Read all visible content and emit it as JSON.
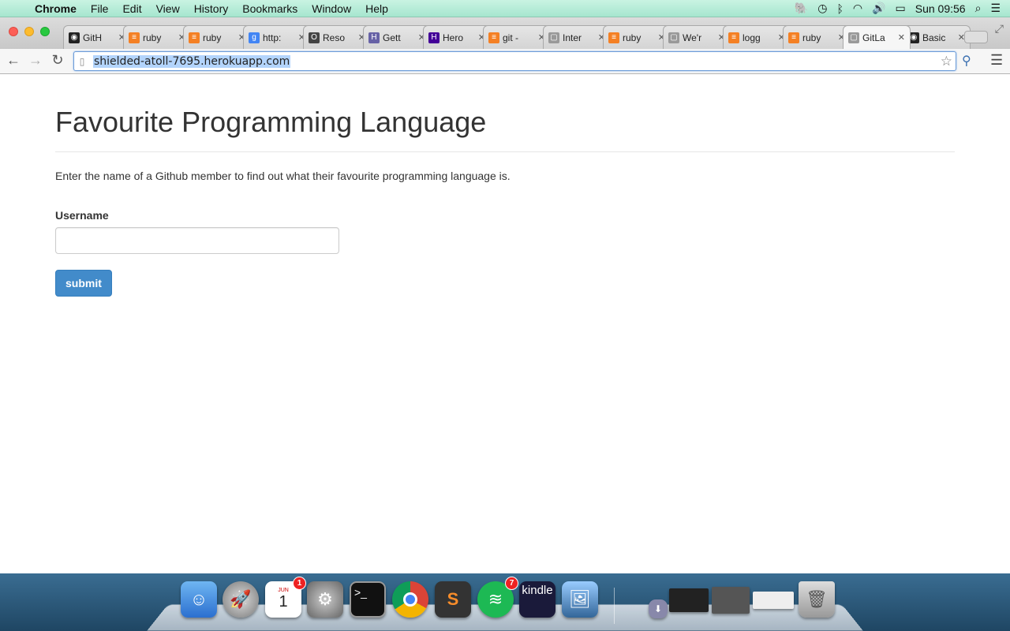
{
  "menubar": {
    "app_name": "Chrome",
    "menus": [
      "File",
      "Edit",
      "View",
      "History",
      "Bookmarks",
      "Window",
      "Help"
    ],
    "clock": "Sun 09:56"
  },
  "tabs": [
    {
      "title": "GitH",
      "icon": "github-icon",
      "color": "#222222",
      "glyph": "◉"
    },
    {
      "title": "ruby",
      "icon": "stackoverflow-icon",
      "color": "#f48024",
      "glyph": "≡"
    },
    {
      "title": "ruby",
      "icon": "stackoverflow-icon",
      "color": "#f48024",
      "glyph": "≡"
    },
    {
      "title": "http:",
      "icon": "google-icon",
      "color": "#4285f4",
      "glyph": "g"
    },
    {
      "title": "Reso",
      "icon": "resource-icon",
      "color": "#444444",
      "glyph": "O"
    },
    {
      "title": "Gett",
      "icon": "heroku-icon",
      "color": "#6762a6",
      "glyph": "H"
    },
    {
      "title": "Hero",
      "icon": "heroku-icon",
      "color": "#430098",
      "glyph": "H"
    },
    {
      "title": "git -",
      "icon": "stackoverflow-icon",
      "color": "#f48024",
      "glyph": "≡"
    },
    {
      "title": "Inter",
      "icon": "page-icon",
      "color": "#999999",
      "glyph": "▢"
    },
    {
      "title": "ruby",
      "icon": "stackoverflow-icon",
      "color": "#f48024",
      "glyph": "≡"
    },
    {
      "title": "We'r",
      "icon": "page-icon",
      "color": "#999999",
      "glyph": "▢"
    },
    {
      "title": "logg",
      "icon": "stackoverflow-icon",
      "color": "#f48024",
      "glyph": "≡"
    },
    {
      "title": "ruby",
      "icon": "stackoverflow-icon",
      "color": "#f48024",
      "glyph": "≡"
    },
    {
      "title": "GitLa",
      "icon": "page-icon",
      "color": "#999999",
      "glyph": "▢",
      "active": true
    },
    {
      "title": "Basic",
      "icon": "github-icon",
      "color": "#222222",
      "glyph": "◉"
    }
  ],
  "address_bar": {
    "url": "shielded-atoll-7695.herokuapp.com"
  },
  "page": {
    "title": "Favourite Programming Language",
    "description": "Enter the name of a Github member to find out what their favourite programming language is.",
    "username_label": "Username",
    "username_value": "",
    "submit_label": "submit"
  },
  "dock": {
    "calendar_date": "1",
    "calendar_badge": "1",
    "calendar_month": "JUN",
    "spotify_badge": "7",
    "kindle_label": "kindle"
  }
}
